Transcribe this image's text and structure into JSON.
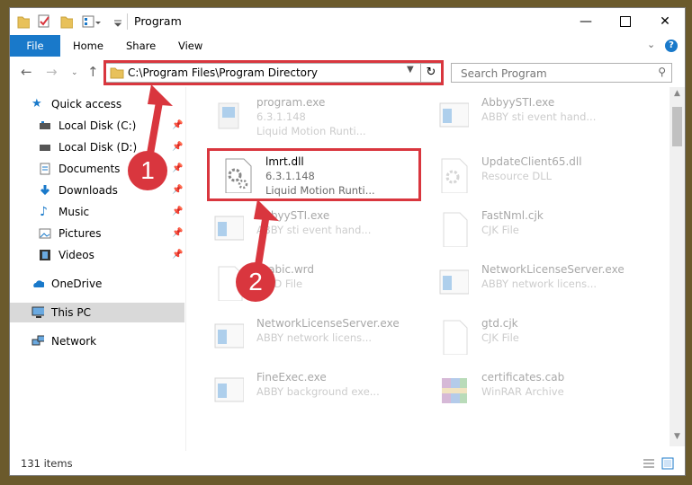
{
  "window": {
    "title": "Program"
  },
  "ribbon": {
    "tabs": [
      "File",
      "Home",
      "Share",
      "View"
    ]
  },
  "address": {
    "path": "C:\\Program Files\\Program Directory"
  },
  "search": {
    "placeholder": "Search Program"
  },
  "sidebar": {
    "items": [
      {
        "label": "Quick access",
        "icon": "star-icon"
      },
      {
        "label": "Local Disk (C:)",
        "icon": "drive-icon",
        "pinned": true
      },
      {
        "label": "Local Disk (D:)",
        "icon": "drive-icon",
        "pinned": true
      },
      {
        "label": "Documents",
        "icon": "documents-icon",
        "pinned": true
      },
      {
        "label": "Downloads",
        "icon": "download-icon",
        "pinned": true
      },
      {
        "label": "Music",
        "icon": "music-icon",
        "pinned": true
      },
      {
        "label": "Pictures",
        "icon": "pictures-icon",
        "pinned": true
      },
      {
        "label": "Videos",
        "icon": "videos-icon",
        "pinned": true
      },
      {
        "label": "OneDrive",
        "icon": "cloud-icon"
      },
      {
        "label": "This PC",
        "icon": "computer-icon",
        "selected": true
      },
      {
        "label": "Network",
        "icon": "network-icon"
      }
    ]
  },
  "files": [
    {
      "name": "program.exe",
      "line2": "6.3.1.148",
      "line3": "Liquid Motion Runti..."
    },
    {
      "name": "AbbyySTI.exe",
      "line2": "ABBY sti event hand...",
      "line3": ""
    },
    {
      "name": "lmrt.dll",
      "line2": "6.3.1.148",
      "line3": "Liquid Motion Runti..."
    },
    {
      "name": "UpdateClient65.dll",
      "line2": "Resource DLL",
      "line3": ""
    },
    {
      "name": "AbbyySTI.exe",
      "line2": "ABBY sti event hand...",
      "line3": ""
    },
    {
      "name": "FastNml.cjk",
      "line2": "CJK File",
      "line3": ""
    },
    {
      "name": "Arabic.wrd",
      "line2": "WRD File",
      "line3": ""
    },
    {
      "name": "NetworkLicenseServer.exe",
      "line2": "ABBY network licens...",
      "line3": ""
    },
    {
      "name": "NetworkLicenseServer.exe",
      "line2": "ABBY network licens...",
      "line3": ""
    },
    {
      "name": "gtd.cjk",
      "line2": "CJK File",
      "line3": ""
    },
    {
      "name": "FineExec.exe",
      "line2": "ABBY background exe...",
      "line3": ""
    },
    {
      "name": "certificates.cab",
      "line2": "WinRAR Archive",
      "line3": ""
    }
  ],
  "status": {
    "count": "131 items"
  },
  "annotations": {
    "step1": "1",
    "step2": "2"
  },
  "colors": {
    "accent": "#1979ca",
    "highlight": "#d9363e"
  }
}
